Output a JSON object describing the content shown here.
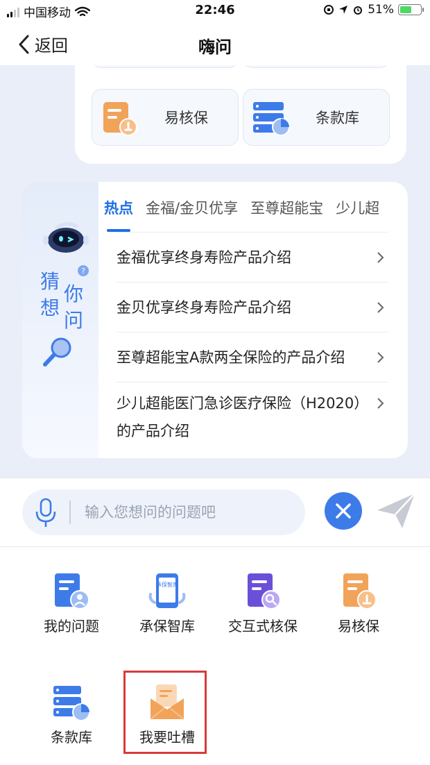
{
  "status_bar": {
    "carrier": "中国移动",
    "time": "22:46",
    "battery": "51%",
    "battery_level": 0.51
  },
  "nav": {
    "back_label": "返回",
    "title": "嗨问"
  },
  "tools": [
    {
      "label": "易核保",
      "icon": "document-stamp-icon"
    },
    {
      "label": "条款库",
      "icon": "database-chart-icon"
    }
  ],
  "guess": {
    "side_chars": [
      "猜",
      "想",
      "你",
      "问"
    ],
    "tabs": [
      {
        "label": "热点",
        "active": true
      },
      {
        "label": "金福/金贝优享",
        "active": false
      },
      {
        "label": "至尊超能宝",
        "active": false
      },
      {
        "label": "少儿超",
        "active": false
      }
    ],
    "questions": [
      "金福优享终身寿险产品介绍",
      "金贝优享终身寿险产品介绍",
      "至尊超能宝A款两全保险的产品介绍",
      "少儿超能医门急诊医疗保险（H2020）的产品介绍"
    ]
  },
  "input": {
    "placeholder": "输入您想问的问题吧"
  },
  "grid": [
    {
      "label": "我的问题",
      "icon": "my-questions-icon"
    },
    {
      "label": "承保智库",
      "icon": "underwriting-library-icon",
      "icon_text": "承保智库"
    },
    {
      "label": "交互式核保",
      "icon": "interactive-underwriting-icon"
    },
    {
      "label": "易核保",
      "icon": "easy-underwriting-icon"
    },
    {
      "label": "条款库",
      "icon": "clause-library-icon"
    },
    {
      "label": "我要吐槽",
      "icon": "feedback-envelope-icon"
    }
  ],
  "colors": {
    "accent": "#1e6fe6",
    "page_bg": "#e9eef8",
    "highlight": "#d83a3a"
  }
}
